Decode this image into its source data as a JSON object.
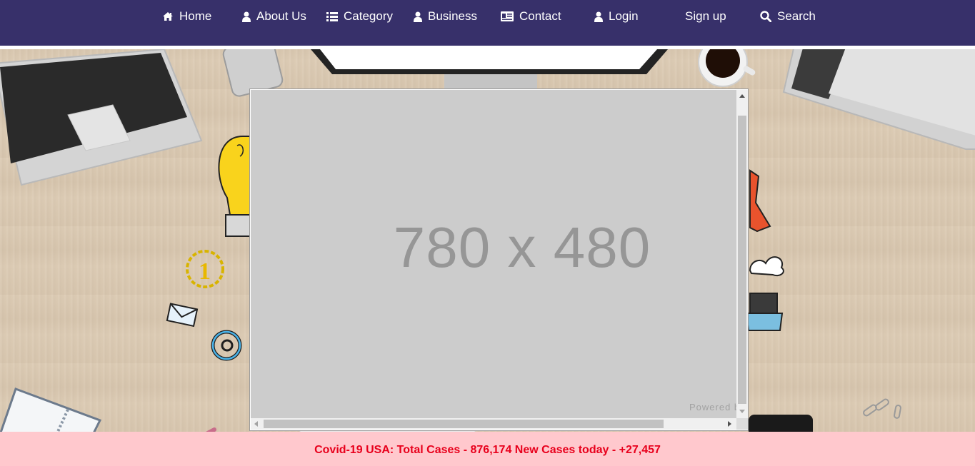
{
  "nav": {
    "items": [
      {
        "label": "Home",
        "icon": "home-icon"
      },
      {
        "label": "About Us",
        "icon": "user-icon"
      },
      {
        "label": "Category",
        "icon": "list-icon"
      },
      {
        "label": "Business",
        "icon": "user-icon"
      },
      {
        "label": "Contact",
        "icon": "id-card-icon"
      },
      {
        "label": "Login",
        "icon": "user-icon"
      },
      {
        "label": "Sign up",
        "icon": ""
      },
      {
        "label": "Search",
        "icon": "search-icon"
      }
    ]
  },
  "embed": {
    "placeholder": "780 x 480",
    "powered_by": "Powered b"
  },
  "ticker": {
    "text": "Covid-19 USA: Total Cases - 876,174 New Cases today - +27,457"
  },
  "colors": {
    "navbar": "#37306a",
    "ticker_text": "#e8001c",
    "ticker_bg": "#ffc0c6"
  }
}
